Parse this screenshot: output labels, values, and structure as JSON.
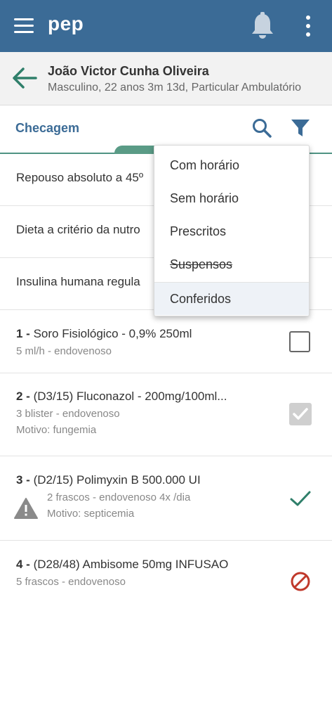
{
  "app": {
    "title": "pep"
  },
  "patient": {
    "name": "João Victor Cunha Oliveira",
    "info": "Masculino, 22 anos 3m 13d, Particular Ambulatório"
  },
  "tab": {
    "label": "Checagem"
  },
  "colors": {
    "primary": "#3b6b96",
    "accent": "#2f7f6a",
    "danger": "#c0392b"
  },
  "filter_menu": {
    "items": [
      {
        "label": "Com horário",
        "style": "normal",
        "selected": false
      },
      {
        "label": "Sem horário",
        "style": "normal",
        "selected": false
      },
      {
        "label": "Prescritos",
        "style": "normal",
        "selected": false
      },
      {
        "label": "Suspensos",
        "style": "strikethrough",
        "selected": false
      },
      {
        "label": "Conferidos",
        "style": "normal",
        "selected": true
      }
    ]
  },
  "care_items": [
    {
      "label": "Repouso absoluto a 45º"
    },
    {
      "label": "Dieta a critério da nutro"
    },
    {
      "label": "Insulina humana regula"
    }
  ],
  "medications": [
    {
      "number": "1 -",
      "name": "Soro Fisiológico - 0,9% 250ml",
      "details": "5 ml/h - endovenoso",
      "reason": "",
      "status": "unchecked",
      "warning": false
    },
    {
      "number": "2 -",
      "name": "(D3/15) Fluconazol - 200mg/100ml...",
      "details": "3 blister - endovenoso",
      "reason": "Motivo: fungemia",
      "status": "checked-disabled",
      "warning": false
    },
    {
      "number": "3 -",
      "name": "(D2/15) Polimyxin B 500.000 UI",
      "details": "2 frascos - endovenoso 4x /dia",
      "reason": "Motivo: septicemia",
      "status": "confirmed",
      "warning": true
    },
    {
      "number": "4 -",
      "name": "(D28/48) Ambisome 50mg INFUSAO",
      "details": "5 frascos - endovenoso",
      "reason": "",
      "status": "suspended",
      "warning": false
    }
  ]
}
